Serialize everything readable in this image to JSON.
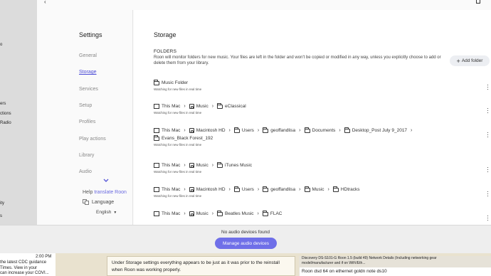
{
  "left_fragments": [
    "o",
    "ers",
    "ctions",
    "Radio",
    "ity",
    "s"
  ],
  "settings": {
    "title": "Settings",
    "nav": [
      "General",
      "Storage",
      "Services",
      "Setup",
      "Profiles",
      "Play actions",
      "Library",
      "Audio"
    ],
    "help_prefix": "Help",
    "help_link": "translate Roon",
    "language_label": "Language",
    "language_value": "English"
  },
  "storage": {
    "title": "Storage",
    "folders_heading": "FOLDERS",
    "description": "Roon will monitor folders for new music. Your files are left in the folder and won't be copied or modified in any way, unless you explicitly choose to add or delete them from your library.",
    "add_folder_label": "Add folder",
    "watching_text": "Watching for new files in real time",
    "folders": [
      {
        "segments": [
          "Music Folder"
        ]
      },
      {
        "segments": [
          "This Mac",
          "Music",
          "eClassical"
        ]
      },
      {
        "segments": [
          "This Mac",
          "Macintosh HD",
          "Users",
          "geoffandlisa",
          "Documents",
          "Desktop_Post July 9_2017"
        ],
        "segments2": [
          "Evans_Black Forest_192"
        ]
      },
      {
        "segments": [
          "This Mac",
          "Music",
          "iTunes Music"
        ]
      },
      {
        "segments": [
          "This Mac",
          "Macintosh HD",
          "Users",
          "geoffandlisa",
          "Music",
          "HDtracks"
        ]
      },
      {
        "segments": [
          "This Mac",
          "Music",
          "Beatles Music",
          "FLAC"
        ]
      }
    ]
  },
  "bottom": {
    "status": "No audio devices found",
    "manage_label": "Manage audio devices"
  },
  "background": {
    "time": "2:00 PM",
    "left_lines": [
      "the latest CDC guidance",
      "Times. View in your",
      "can increase your COVI..."
    ],
    "mid_lines": [
      "Under Storage settings everything appears to be just as it was prior to the reinstall",
      "when Roon was working properly."
    ],
    "right_lines": [
      "Discovery DS-S101-G Roon 1.5 (build 49) Network Details (Including networking gear",
      "model/manufacturer and if on WiFi/Eth...",
      "Roon dsd 64 on ethernet goldn note ds10"
    ]
  }
}
